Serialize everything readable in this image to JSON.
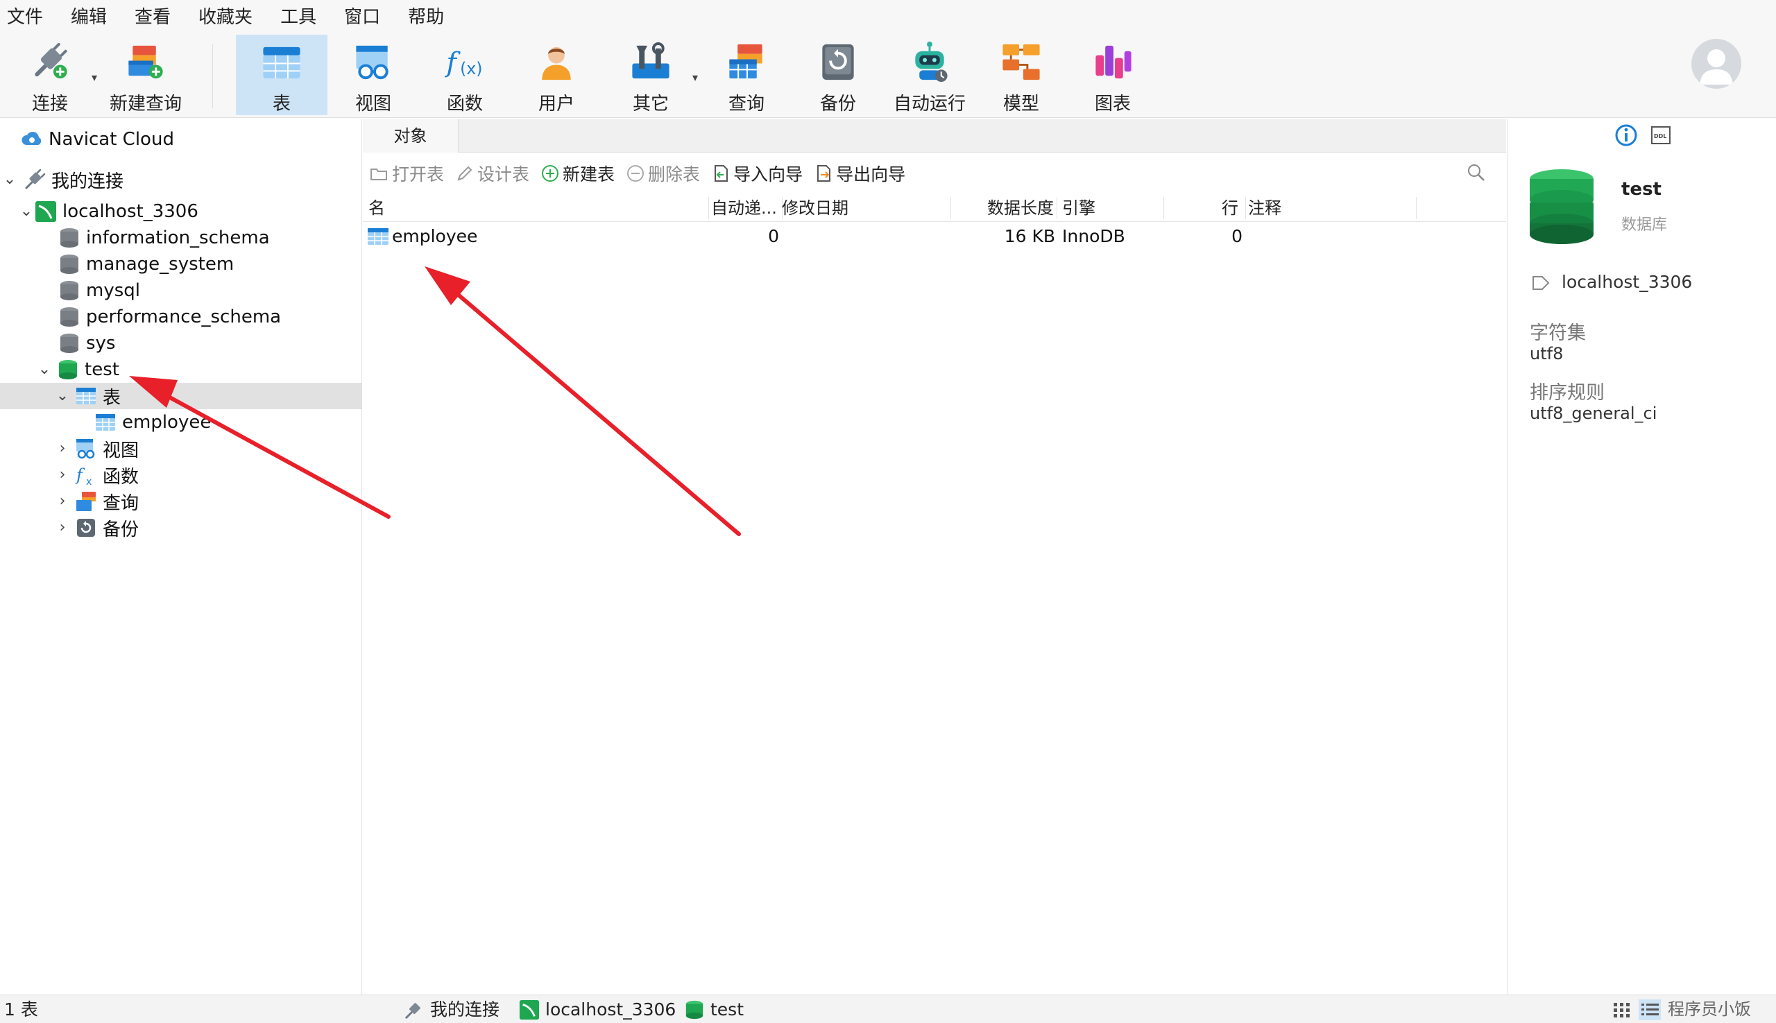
{
  "menu": [
    "文件",
    "编辑",
    "查看",
    "收藏夹",
    "工具",
    "窗口",
    "帮助"
  ],
  "toolbar": {
    "connect": "连接",
    "new_query": "新建查询",
    "table": "表",
    "view": "视图",
    "function": "函数",
    "user": "用户",
    "other": "其它",
    "query": "查询",
    "backup": "备份",
    "automation": "自动运行",
    "model": "模型",
    "chart": "图表"
  },
  "sidebar": {
    "navicat_cloud": "Navicat Cloud",
    "my_connections": "我的连接",
    "connection": "localhost_3306",
    "databases": [
      "information_schema",
      "manage_system",
      "mysql",
      "performance_schema",
      "sys"
    ],
    "active_db": "test",
    "tables_node": "表",
    "table_item": "employee",
    "views_node": "视图",
    "functions_node": "函数",
    "queries_node": "查询",
    "backups_node": "备份"
  },
  "center": {
    "tab_label": "对象",
    "actions": {
      "open_table": "打开表",
      "design_table": "设计表",
      "new_table": "新建表",
      "delete_table": "删除表",
      "import_wizard": "导入向导",
      "export_wizard": "导出向导"
    },
    "columns": {
      "name": "名",
      "auto_increment": "自动递...",
      "modified": "修改日期",
      "data_length": "数据长度",
      "engine": "引擎",
      "rows": "行",
      "comment": "注释"
    },
    "rows": [
      {
        "name": "employee",
        "auto_increment": "0",
        "modified": "",
        "data_length": "16 KB",
        "engine": "InnoDB",
        "rows": "0",
        "comment": ""
      }
    ]
  },
  "info_panel": {
    "db_name": "test",
    "db_type": "数据库",
    "connection": "localhost_3306",
    "charset_label": "字符集",
    "charset_value": "utf8",
    "collation_label": "排序规则",
    "collation_value": "utf8_general_ci"
  },
  "status": {
    "count": "1 表",
    "crumb_connections": "我的连接",
    "crumb_connection": "localhost_3306",
    "crumb_db": "test",
    "watermark": "程序员小饭"
  },
  "colors": {
    "accent": "#1a7fd4",
    "db_green": "#1fa651",
    "arrow_red": "#e8202a",
    "selected_row": "#e1e1e1",
    "active_tool": "#cde4f7"
  }
}
